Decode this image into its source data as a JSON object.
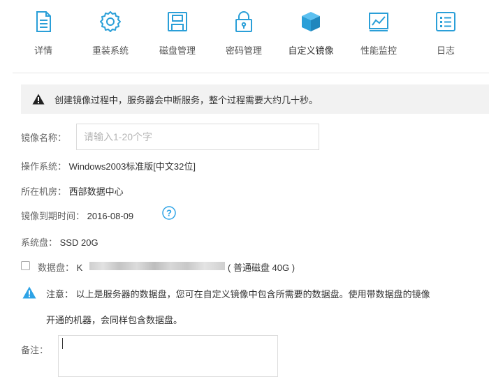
{
  "toolbar": {
    "items": [
      {
        "label": "详情",
        "icon": "document-icon"
      },
      {
        "label": "重装系统",
        "icon": "gear-icon"
      },
      {
        "label": "磁盘管理",
        "icon": "disk-icon"
      },
      {
        "label": "密码管理",
        "icon": "lock-icon"
      },
      {
        "label": "自定义镜像",
        "icon": "cube-icon"
      },
      {
        "label": "性能监控",
        "icon": "chart-monitor-icon"
      },
      {
        "label": "日志",
        "icon": "list-icon"
      }
    ],
    "active_index": 4
  },
  "warning": {
    "text": "创建镜像过程中，服务器会中断服务，整个过程需要大约几十秒。",
    "icon": "warning-icon"
  },
  "form": {
    "image_name": {
      "label": "镜像名称：",
      "placeholder": "请输入1-20个字",
      "value": ""
    },
    "os": {
      "label": "操作系统：",
      "value": "Windows2003标准版[中文32位]"
    },
    "datacenter": {
      "label": "所在机房：",
      "value": "西部数据中心"
    },
    "expiry": {
      "label": "镜像到期时间：",
      "value": "2016-08-09",
      "help_icon": "question-icon"
    },
    "system_disk": {
      "label": "系统盘：",
      "value": "SSD 20G"
    },
    "data_disk": {
      "label": "数据盘：",
      "value_prefix": "K",
      "detail": "( 普通磁盘 40G )",
      "checked": false
    },
    "note": {
      "label": "注意：",
      "line1": "以上是服务器的数据盘，您可在自定义镜像中包含所需要的数据盘。使用带数据盘的镜像",
      "line2": "开通的机器，会同样包含数据盘。"
    },
    "remark": {
      "label": "备注：",
      "value": ""
    }
  },
  "colors": {
    "accent_blue": "#2ea3e6",
    "icon_blue": "#2a9fd8",
    "warning_bg": "#f2f2f2"
  }
}
